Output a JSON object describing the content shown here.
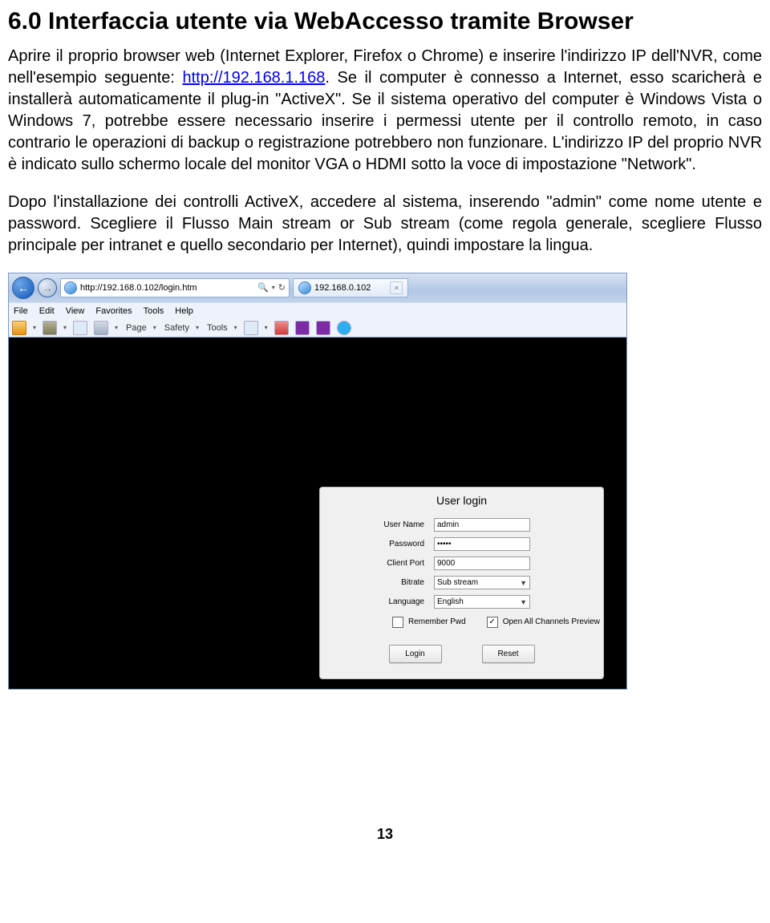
{
  "heading": "6.0 Interfaccia utente via WebAccesso tramite Browser",
  "paragraph1_a": "Aprire il proprio browser web (Internet Explorer, Firefox o Chrome) e inserire l'indirizzo IP dell'NVR, come nell'esempio seguente: ",
  "paragraph1_link": "http://192.168.1.168",
  "paragraph1_b": ". Se il computer è connesso a Internet, esso scaricherà e installerà automaticamente il plug-in \"ActiveX\". Se il sistema operativo del computer è Windows Vista o Windows 7, potrebbe essere necessario inserire i permessi utente per il controllo remoto, in caso contrario le operazioni di backup o registrazione potrebbero non funzionare. L'indirizzo IP del proprio NVR è indicato sullo schermo locale del monitor VGA o HDMI sotto la voce di impostazione \"Network\".",
  "paragraph2": "Dopo l'installazione dei controlli ActiveX, accedere al sistema, inserendo \"admin\" come nome utente e password. Scegliere il Flusso Main stream or Sub stream (come regola generale, scegliere Flusso principale per intranet e quello secondario per Internet), quindi impostare la lingua.",
  "page_number": "13",
  "browser": {
    "address": "http://192.168.0.102/login.htm",
    "search_glyph": "🔍",
    "refresh_glyph": "↻",
    "dropdown_glyph": "▾",
    "tab_title": "192.168.0.102",
    "tab_close": "×",
    "back_glyph": "←",
    "fwd_glyph": "→",
    "menu": [
      "File",
      "Edit",
      "View",
      "Favorites",
      "Tools",
      "Help"
    ],
    "toolbar": {
      "page": "Page",
      "safety": "Safety",
      "tools": "Tools",
      "tri": "▾"
    }
  },
  "login": {
    "title": "User login",
    "user_name_label": "User Name",
    "user_name_value": "admin",
    "password_label": "Password",
    "password_value": "•••••",
    "client_port_label": "Client Port",
    "client_port_value": "9000",
    "bitrate_label": "Bitrate",
    "bitrate_value": "Sub stream",
    "language_label": "Language",
    "language_value": "English",
    "remember_label": "Remember Pwd",
    "preview_label": "Open All Channels Preview",
    "preview_check": "✓",
    "login_btn": "Login",
    "reset_btn": "Reset"
  }
}
